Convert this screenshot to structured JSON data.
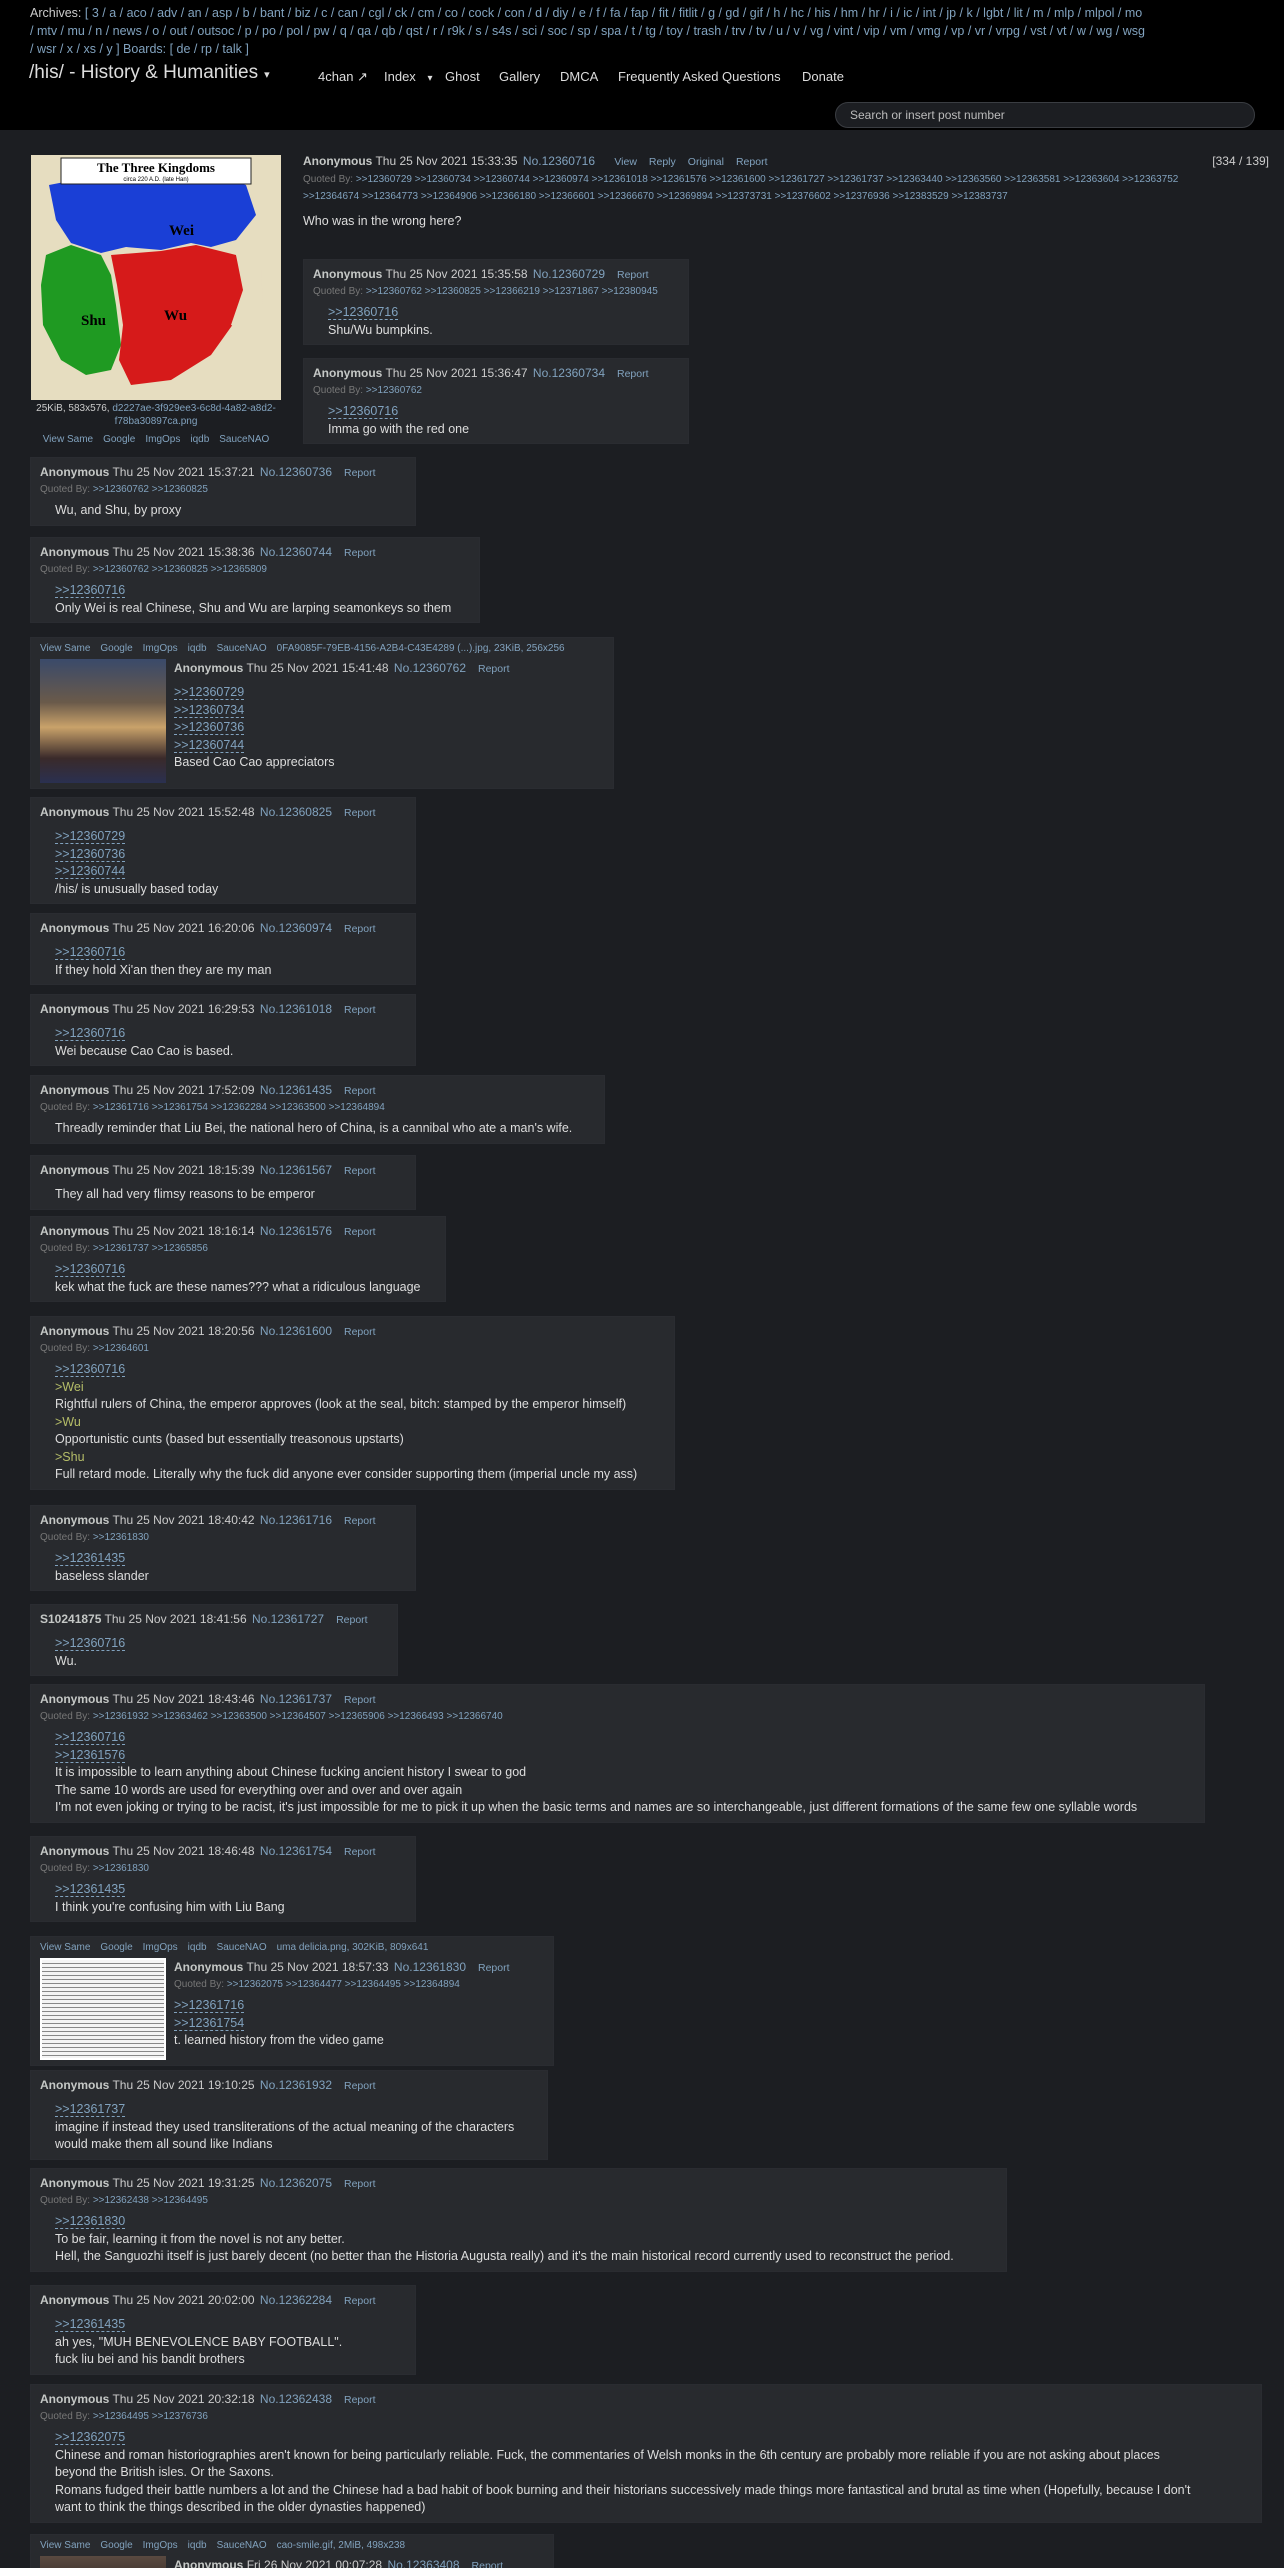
{
  "archives_label": "Archives:",
  "archives_line1": "[ 3 / a / aco / adv / an / asp / b / bant / biz / c / can / cgl / ck / cm / co / cock / con / d / diy / e / f / fa / fap / fit / fitlit / g / gd / gif / h / hc / his / hm / hr / i / ic / int / jp / k / lgbt / lit / m / mlp / mlpol / mo",
  "archives_line2": "/ mtv / mu / n / news / o / out / outsoc / p / po / pol / pw / q / qa / qb / qst / r / r9k / s / s4s / sci / soc / sp / spa / t / tg / toy / trash / trv / tv / u / v / vg / vint / vip / vm / vmg / vp / vr / vrpg / vst / vt / w / wg / wsg",
  "archives_line3": "/ wsr / x / xs / y ] Boards: [ de / rp / talk ]",
  "board_title": "/his/ - History & Humanities",
  "nav": {
    "fourchan": "4chan",
    "index": "Index",
    "ghost": "Ghost",
    "gallery": "Gallery",
    "dmca": "DMCA",
    "faq": "Frequently Asked Questions",
    "donate": "Donate"
  },
  "search_placeholder": "Search or insert post number",
  "op": {
    "thumb_title": "The Three Kingdoms",
    "thumb_sub": "circa 220 A.D. (late Han)",
    "map_wei": "Wei",
    "map_shu": "Shu",
    "map_wu": "Wu",
    "file_meta": "25KiB, 583x576,",
    "file_name": "d2227ae-3f929ee3-6c8d-4a82-a8d2-f78ba30897ca.png",
    "img_links": [
      "View Same",
      "Google",
      "ImgOps",
      "iqdb",
      "SauceNAO"
    ],
    "name": "Anonymous",
    "date": "Thu 25 Nov 2021 15:33:35",
    "no": "No.12360716",
    "actions": [
      "View",
      "Reply",
      "Original",
      "Report"
    ],
    "counter": "[334 / 139]",
    "quoted_label": "Quoted By:",
    "quoted_line1": ">>12360729 >>12360734 >>12360744 >>12360974 >>12361018 >>12361576 >>12361600 >>12361727 >>12361737 >>12363440 >>12363560 >>12363581 >>12363604 >>12363752",
    "quoted_line2": ">>12364674 >>12364773 >>12364906 >>12366180 >>12366601 >>12366670 >>12369894 >>12373731 >>12376602 >>12376936 >>12383529 >>12383737",
    "text": "Who was in the wrong here?"
  },
  "report": "Report",
  "posts": [
    {
      "name": "Anonymous",
      "date": "Thu 25 Nov 2021 15:35:58",
      "no": "No.12360729",
      "quoted": ">>12360762 >>12360825 >>12366219 >>12371867 >>12380945",
      "lines": [
        {
          "q": ">>12360716"
        },
        {
          "t": "Shu/Wu bumpkins."
        }
      ]
    },
    {
      "name": "Anonymous",
      "date": "Thu 25 Nov 2021 15:36:47",
      "no": "No.12360734",
      "quoted": ">>12360762",
      "lines": [
        {
          "q": ">>12360716"
        },
        {
          "t": "Imma go with the red one"
        }
      ]
    },
    {
      "name": "Anonymous",
      "date": "Thu 25 Nov 2021 15:37:21",
      "no": "No.12360736",
      "quoted": ">>12360762 >>12360825",
      "lines": [
        {
          "t": "Wu, and Shu, by proxy"
        }
      ]
    },
    {
      "name": "Anonymous",
      "date": "Thu 25 Nov 2021 15:38:36",
      "no": "No.12360744",
      "quoted": ">>12360762 >>12360825 >>12365809",
      "lines": [
        {
          "q": ">>12360716"
        },
        {
          "t": "Only Wei is real Chinese, Shu and Wu are larping seamonkeys so them"
        }
      ]
    },
    {
      "name": "Anonymous",
      "date": "Thu 25 Nov 2021 15:41:48",
      "no": "No.12360762",
      "file": "0FA9085F-79EB-4156-A2B4-C43E4289 (...).jpg, 23KiB, 256x256",
      "lines": [
        {
          "q": ">>12360729"
        },
        {
          "q": ">>12360734"
        },
        {
          "q": ">>12360736"
        },
        {
          "q": ">>12360744"
        },
        {
          "t": "Based Cao Cao appreciators"
        }
      ]
    },
    {
      "name": "Anonymous",
      "date": "Thu 25 Nov 2021 15:52:48",
      "no": "No.12360825",
      "lines": [
        {
          "q": ">>12360729"
        },
        {
          "q": ">>12360736"
        },
        {
          "q": ">>12360744"
        },
        {
          "t": "/his/ is unusually based today"
        }
      ]
    },
    {
      "name": "Anonymous",
      "date": "Thu 25 Nov 2021 16:20:06",
      "no": "No.12360974",
      "lines": [
        {
          "q": ">>12360716"
        },
        {
          "t": "If they hold Xi'an then they are my man"
        }
      ]
    },
    {
      "name": "Anonymous",
      "date": "Thu 25 Nov 2021 16:29:53",
      "no": "No.12361018",
      "lines": [
        {
          "q": ">>12360716"
        },
        {
          "t": "Wei because Cao Cao is based."
        }
      ]
    },
    {
      "name": "Anonymous",
      "date": "Thu 25 Nov 2021 17:52:09",
      "no": "No.12361435",
      "quoted": ">>12361716 >>12361754 >>12362284 >>12363500 >>12364894",
      "lines": [
        {
          "t": "Threadly reminder that Liu Bei, the national hero of China, is a cannibal who ate a man's wife."
        }
      ]
    },
    {
      "name": "Anonymous",
      "date": "Thu 25 Nov 2021 18:15:39",
      "no": "No.12361567",
      "lines": [
        {
          "t": "They all had very flimsy reasons to be emperor"
        }
      ]
    },
    {
      "name": "Anonymous",
      "date": "Thu 25 Nov 2021 18:16:14",
      "no": "No.12361576",
      "quoted": ">>12361737 >>12365856",
      "lines": [
        {
          "q": ">>12360716"
        },
        {
          "t": "kek what the fuck are these names??? what a ridiculous language"
        }
      ]
    },
    {
      "name": "Anonymous",
      "date": "Thu 25 Nov 2021 18:20:56",
      "no": "No.12361600",
      "quoted": ">>12364601",
      "lines": [
        {
          "q": ">>12360716"
        },
        {
          "g": ">Wei"
        },
        {
          "t": "Rightful rulers of China, the emperor approves (look at the seal, bitch: stamped by the emperor himself)"
        },
        {
          "g": ">Wu"
        },
        {
          "t": "Opportunistic cunts (based but essentially treasonous upstarts)"
        },
        {
          "g": ">Shu"
        },
        {
          "t": "Full retard mode. Literally why the fuck did anyone ever consider supporting them (imperial uncle my ass)"
        }
      ]
    },
    {
      "name": "Anonymous",
      "date": "Thu 25 Nov 2021 18:40:42",
      "no": "No.12361716",
      "quoted": ">>12361830",
      "lines": [
        {
          "q": ">>12361435"
        },
        {
          "t": "baseless slander"
        }
      ]
    },
    {
      "name": "S10241875",
      "date": "Thu 25 Nov 2021 18:41:56",
      "no": "No.12361727",
      "lines": [
        {
          "q": ">>12360716"
        },
        {
          "t": "Wu."
        }
      ]
    },
    {
      "name": "Anonymous",
      "date": "Thu 25 Nov 2021 18:43:46",
      "no": "No.12361737",
      "quoted": ">>12361932 >>12363462 >>12363500 >>12364507 >>12365906 >>12366493 >>12366740",
      "lines": [
        {
          "q": ">>12360716"
        },
        {
          "q": ">>12361576"
        },
        {
          "t": "It is impossible to learn anything about Chinese fucking ancient history I swear to god"
        },
        {
          "t": "The same 10 words are used for everything over and over and over again"
        },
        {
          "t": "I'm not even joking or trying to be racist, it's just impossible for me to pick it up when the basic terms and names are so interchangeable, just different formations of the same few one syllable words"
        }
      ]
    },
    {
      "name": "Anonymous",
      "date": "Thu 25 Nov 2021 18:46:48",
      "no": "No.12361754",
      "quoted": ">>12361830",
      "lines": [
        {
          "q": ">>12361435"
        },
        {
          "t": "I think you're confusing him with Liu Bang"
        }
      ]
    },
    {
      "name": "Anonymous",
      "date": "Thu 25 Nov 2021 18:57:33",
      "no": "No.12361830",
      "file": "uma delicia.png, 302KiB, 809x641",
      "quoted": ">>12362075 >>12364477 >>12364495 >>12364894",
      "lines": [
        {
          "q": ">>12361716"
        },
        {
          "q": ">>12361754"
        },
        {
          "t": "t. learned history from the video game"
        }
      ]
    },
    {
      "name": "Anonymous",
      "date": "Thu 25 Nov 2021 19:10:25",
      "no": "No.12361932",
      "lines": [
        {
          "q": ">>12361737"
        },
        {
          "t": "imagine if instead they used transliterations of the actual meaning of the characters"
        },
        {
          "t": "would make them all sound like Indians"
        }
      ]
    },
    {
      "name": "Anonymous",
      "date": "Thu 25 Nov 2021 19:31:25",
      "no": "No.12362075",
      "quoted": ">>12362438 >>12364495",
      "lines": [
        {
          "q": ">>12361830"
        },
        {
          "t": "To be fair, learning it from the novel is not any better."
        },
        {
          "t": "Hell, the Sanguozhi itself is just barely decent (no better than the Historia Augusta really) and it's the main historical record currently used to reconstruct the period."
        }
      ]
    },
    {
      "name": "Anonymous",
      "date": "Thu 25 Nov 2021 20:02:00",
      "no": "No.12362284",
      "lines": [
        {
          "q": ">>12361435"
        },
        {
          "t": "ah yes, \"MUH BENEVOLENCE BABY FOOTBALL\"."
        },
        {
          "t": "fuck liu bei and his bandit brothers"
        }
      ]
    },
    {
      "name": "Anonymous",
      "date": "Thu 25 Nov 2021 20:32:18",
      "no": "No.12362438",
      "quoted": ">>12364495 >>12376736",
      "lines": [
        {
          "q": ">>12362075"
        },
        {
          "t": "Chinese and roman historiographies aren't known for being particularly reliable. Fuck, the commentaries of Welsh monks in the 6th century are probably more reliable if you are not asking about places"
        },
        {
          "t": "beyond the British isles. Or the Saxons."
        },
        {
          "t": "Romans fudged their battle numbers a lot and the Chinese had a bad habit of book burning and their historians successively made things more fantastical and brutal as time when (Hopefully, because I don't"
        },
        {
          "t": "want to think the things described in the older dynasties happened)"
        }
      ]
    },
    {
      "name": "Anonymous",
      "date": "Fri 26 Nov 2021 00:07:28",
      "no": "No.12363408",
      "file": "cao-smile.gif, 2MiB, 498x238",
      "lines": []
    }
  ]
}
